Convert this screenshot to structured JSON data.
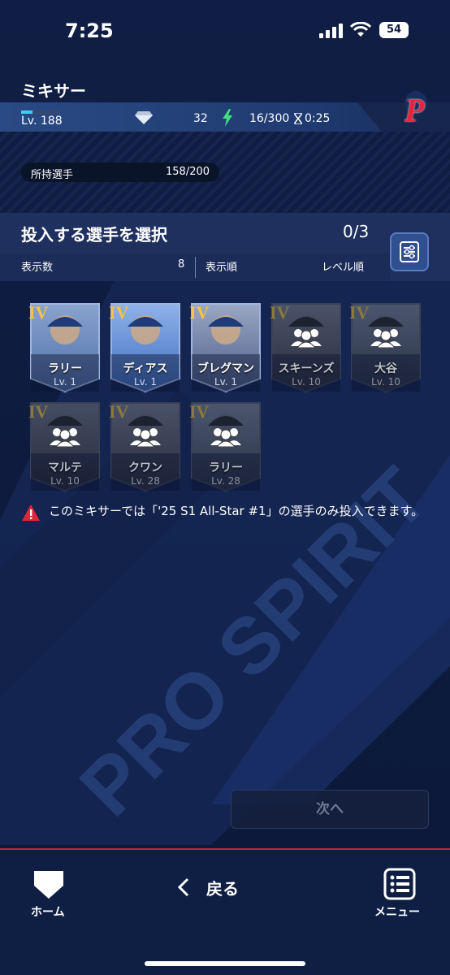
{
  "status_bar": {
    "time": "7:25",
    "battery": "54"
  },
  "header": {
    "title": "ミキサー",
    "level": "Lv. 188",
    "gems": "32",
    "stamina": "16/300",
    "timer": "0:25",
    "team_logo_letter": "P"
  },
  "ownership": {
    "label": "所持選手",
    "value": "158/200"
  },
  "selection": {
    "title": "投入する選手を選択",
    "count": "0/3",
    "display_count_label": "表示数",
    "display_count_value": "8",
    "sort_label": "表示順",
    "sort_value": "レベル順"
  },
  "cards": [
    {
      "badge": "IV",
      "name": "ラリー",
      "level": "Lv. 1",
      "dim": false
    },
    {
      "badge": "IV",
      "name": "ディアス",
      "level": "Lv. 1",
      "dim": false
    },
    {
      "badge": "IV",
      "name": "ブレグマン",
      "level": "Lv. 1",
      "dim": false
    },
    {
      "badge": "IV",
      "name": "スキーンズ",
      "level": "Lv. 10",
      "dim": true
    },
    {
      "badge": "IV",
      "name": "大谷",
      "level": "Lv. 10",
      "dim": true
    },
    {
      "badge": "IV",
      "name": "マルテ",
      "level": "Lv. 10",
      "dim": true
    },
    {
      "badge": "IV",
      "name": "クワン",
      "level": "Lv. 28",
      "dim": true
    },
    {
      "badge": "IV",
      "name": "ラリー",
      "level": "Lv. 28",
      "dim": true
    }
  ],
  "warning": "このミキサーでは「'25 S1 All-Star #1」の選手のみ投入できます。",
  "background_text": "PRO SPIRIT",
  "next_button": "次へ",
  "nav": {
    "home": "ホーム",
    "back": "戻る",
    "menu": "メニュー"
  },
  "colors": {
    "accent_red": "#c0283a",
    "badge_gold": "#f5c542",
    "bg": "#0e1d3f"
  }
}
